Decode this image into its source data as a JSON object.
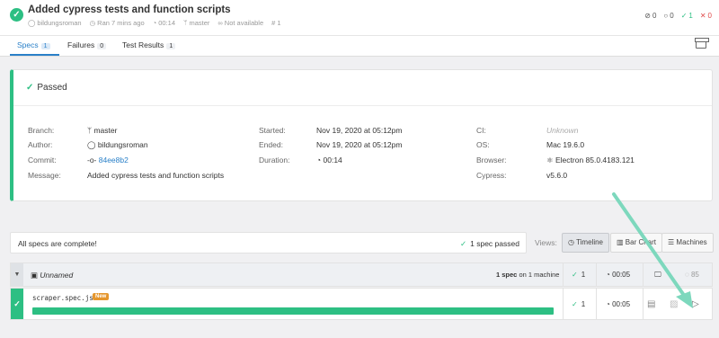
{
  "header": {
    "title": "Added cypress tests and function scripts",
    "author": "bildungsroman",
    "ran": "Ran 7 mins ago",
    "duration": "00:14",
    "branch": "master",
    "availability": "Not available",
    "run_number": "1"
  },
  "counts": {
    "skipped": "0",
    "pending": "0",
    "passed": "1",
    "failed": "0"
  },
  "tabs": [
    {
      "label": "Specs",
      "count": "1"
    },
    {
      "label": "Failures",
      "count": "0"
    },
    {
      "label": "Test Results",
      "count": "1"
    }
  ],
  "card": {
    "status": "Passed",
    "branch_label": "Branch:",
    "branch_value": "master",
    "author_label": "Author:",
    "author_value": "bildungsroman",
    "commit_label": "Commit:",
    "commit_value": "84ee8b2",
    "message_label": "Message:",
    "message_value": "Added cypress tests and function scripts",
    "started_label": "Started:",
    "started_value": "Nov 19, 2020 at 05:12pm",
    "ended_label": "Ended:",
    "ended_value": "Nov 19, 2020 at 05:12pm",
    "duration_label": "Duration:",
    "duration_value": "00:14",
    "ci_label": "CI:",
    "ci_value": "Unknown",
    "os_label": "OS:",
    "os_value": "Mac 19.6.0",
    "browser_label": "Browser:",
    "browser_value": "Electron 85.0.4183.121",
    "cypress_label": "Cypress:",
    "cypress_value": "v5.6.0"
  },
  "summary": {
    "complete_text": "All specs are complete!",
    "passed_text": "1 spec passed",
    "views_label": "Views:",
    "views": [
      "Timeline",
      "Bar Chart",
      "Machines"
    ]
  },
  "group": {
    "name": "Unnamed",
    "spec_count": "1 spec",
    "on_machine": "on 1 machine",
    "passed": "1",
    "duration": "00:05",
    "score": "85"
  },
  "spec": {
    "file": "scraper.spec.js",
    "badge": "New",
    "passed": "1",
    "duration": "00:05",
    "progress": 1.0
  },
  "colors": {
    "pass": "#2dbf83",
    "link": "#2a80c8",
    "fail": "#e04b4b",
    "badge": "#e5962d"
  }
}
